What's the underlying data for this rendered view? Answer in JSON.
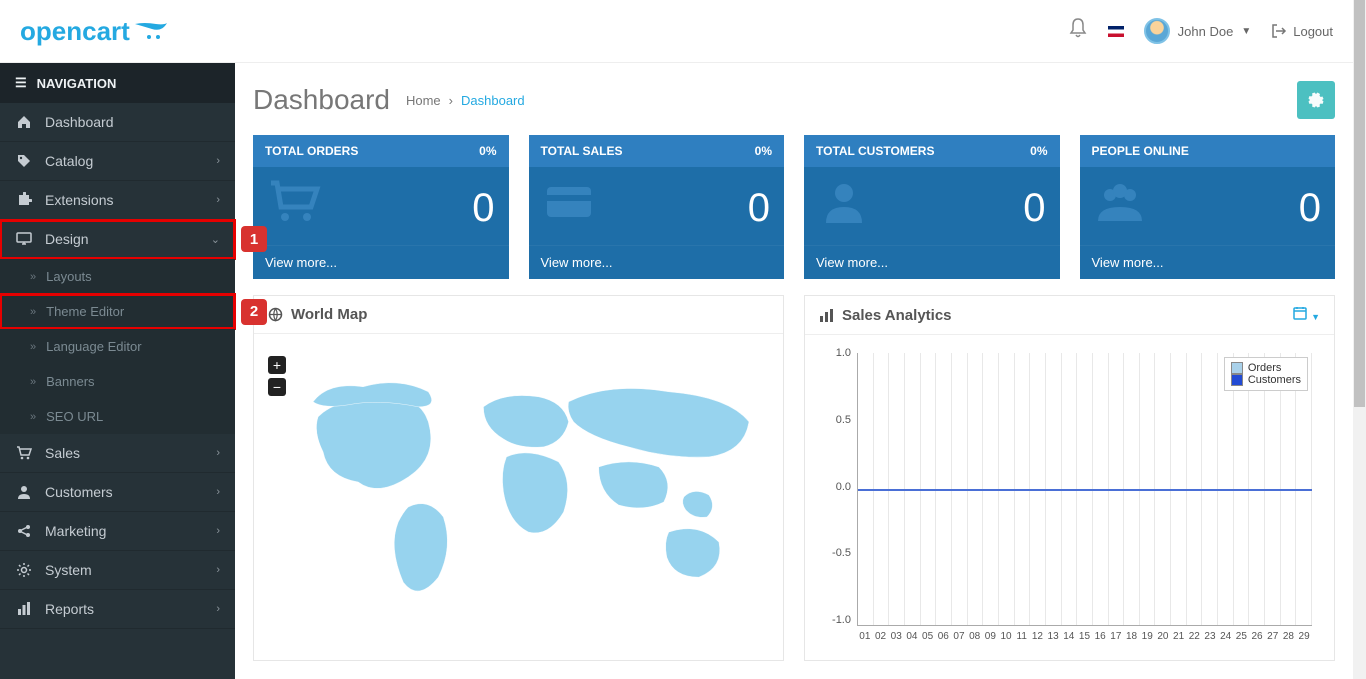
{
  "header": {
    "logo_text": "opencart",
    "username": "John Doe",
    "logout": "Logout"
  },
  "sidebar": {
    "title": "NAVIGATION",
    "items": [
      {
        "icon": "home",
        "label": "Dashboard",
        "chev": false
      },
      {
        "icon": "tag",
        "label": "Catalog",
        "chev": true
      },
      {
        "icon": "puzzle",
        "label": "Extensions",
        "chev": true
      },
      {
        "icon": "desktop",
        "label": "Design",
        "chev": true,
        "expanded": true,
        "highlight": 1,
        "subs": [
          {
            "label": "Layouts"
          },
          {
            "label": "Theme Editor",
            "highlight": 2
          },
          {
            "label": "Language Editor"
          },
          {
            "label": "Banners"
          },
          {
            "label": "SEO URL"
          }
        ]
      },
      {
        "icon": "cart",
        "label": "Sales",
        "chev": true
      },
      {
        "icon": "person",
        "label": "Customers",
        "chev": true
      },
      {
        "icon": "share",
        "label": "Marketing",
        "chev": true
      },
      {
        "icon": "gear",
        "label": "System",
        "chev": true
      },
      {
        "icon": "bar",
        "label": "Reports",
        "chev": true
      }
    ]
  },
  "page": {
    "title": "Dashboard",
    "crumb_home": "Home",
    "crumb_sep": "›",
    "crumb_active": "Dashboard"
  },
  "tiles": [
    {
      "title": "TOTAL ORDERS",
      "pct": "0%",
      "value": "0",
      "footer": "View more...",
      "icon": "cart"
    },
    {
      "title": "TOTAL SALES",
      "pct": "0%",
      "value": "0",
      "footer": "View more...",
      "icon": "card"
    },
    {
      "title": "TOTAL CUSTOMERS",
      "pct": "0%",
      "value": "0",
      "footer": "View more...",
      "icon": "person"
    },
    {
      "title": "PEOPLE ONLINE",
      "pct": "",
      "value": "0",
      "footer": "View more...",
      "icon": "people"
    }
  ],
  "map_panel": {
    "title": "World Map",
    "plus": "+",
    "minus": "−"
  },
  "sales_panel": {
    "title": "Sales Analytics",
    "legend_orders": "Orders",
    "legend_customers": "Customers"
  },
  "chart_data": {
    "type": "line",
    "title": "Sales Analytics",
    "xlabel": "",
    "ylabel": "",
    "ylim": [
      -1.0,
      1.0
    ],
    "y_ticks": [
      1.0,
      0.5,
      0.0,
      -0.5,
      -1.0
    ],
    "categories": [
      "01",
      "02",
      "03",
      "04",
      "05",
      "06",
      "07",
      "08",
      "09",
      "10",
      "11",
      "12",
      "13",
      "14",
      "15",
      "16",
      "17",
      "18",
      "19",
      "20",
      "21",
      "22",
      "23",
      "24",
      "25",
      "26",
      "27",
      "28",
      "29"
    ],
    "series": [
      {
        "name": "Orders",
        "values": [
          0,
          0,
          0,
          0,
          0,
          0,
          0,
          0,
          0,
          0,
          0,
          0,
          0,
          0,
          0,
          0,
          0,
          0,
          0,
          0,
          0,
          0,
          0,
          0,
          0,
          0,
          0,
          0,
          0
        ]
      },
      {
        "name": "Customers",
        "values": [
          0,
          0,
          0,
          0,
          0,
          0,
          0,
          0,
          0,
          0,
          0,
          0,
          0,
          0,
          0,
          0,
          0,
          0,
          0,
          0,
          0,
          0,
          0,
          0,
          0,
          0,
          0,
          0,
          0
        ]
      }
    ]
  }
}
